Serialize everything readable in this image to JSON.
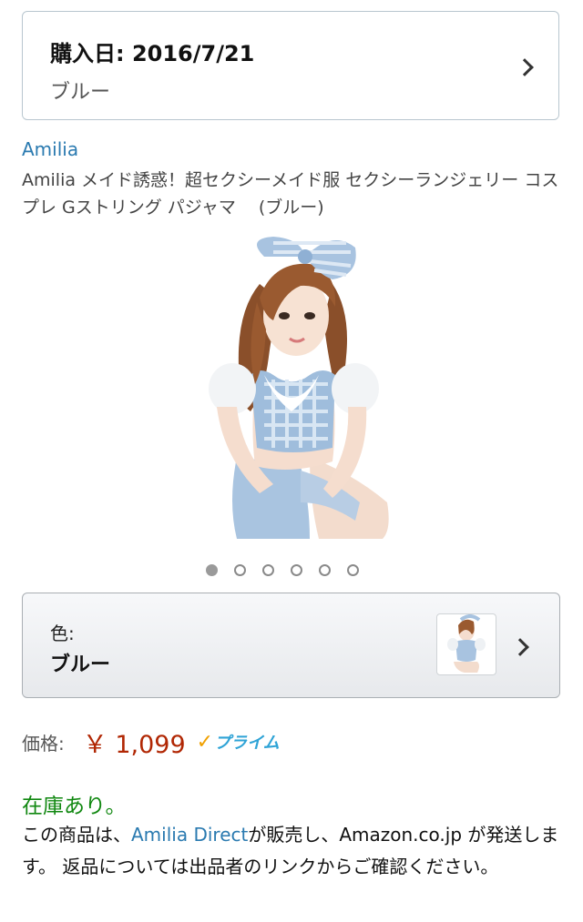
{
  "purchase_history": {
    "date_label": "購入日: 2016/7/21",
    "variant": "ブルー"
  },
  "product": {
    "brand": "Amilia",
    "title": "Amilia メイド誘惑！超セクシーメイド服 セクシーランジェリー コスプレ Gストリング パジャマ　 (ブルー)",
    "image_icon": "product-photo"
  },
  "carousel": {
    "total": 6,
    "active_index": 0
  },
  "color_selector": {
    "label": "色:",
    "value": "ブルー"
  },
  "price": {
    "label": "価格:",
    "value": "￥ 1,099",
    "prime_check": "✓",
    "prime_text": "プライム"
  },
  "availability": {
    "status": "在庫あり。",
    "seller_prefix": "この商品は、",
    "seller_name": "Amilia Direct",
    "seller_suffix": "が販売し、Amazon.co.jp が発送します。 返品については出品者のリンクからご確認ください。"
  },
  "colors": {
    "link": "#2a7ab0",
    "price": "#b12704",
    "in_stock": "#118811",
    "prime_blue": "#2ea3d6",
    "prime_check": "#f0a000"
  }
}
